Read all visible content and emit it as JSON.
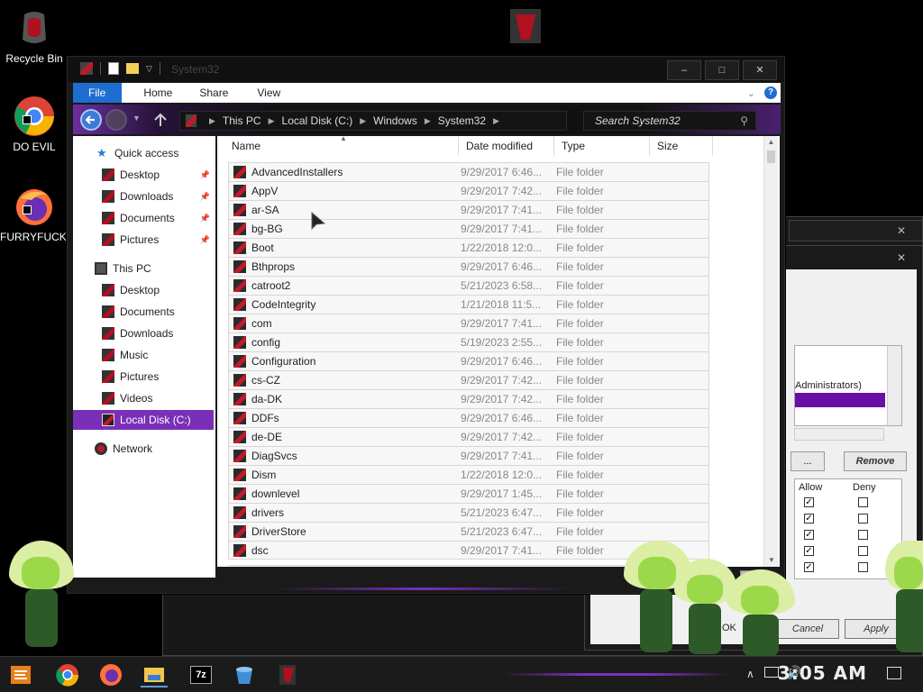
{
  "desktop": {
    "icons": [
      {
        "label": "Recycle Bin"
      },
      {
        "label": "DO EVIL"
      },
      {
        "label": "FURRYFUCK!"
      }
    ]
  },
  "explorer": {
    "title": "System32",
    "ribbon_tabs": [
      "File",
      "Home",
      "Share",
      "View"
    ],
    "breadcrumb": [
      "This PC",
      "Local Disk (C:)",
      "Windows",
      "System32"
    ],
    "search_placeholder": "Search System32",
    "nav": {
      "quick_access": "Quick access",
      "quick_items": [
        "Desktop",
        "Downloads",
        "Documents",
        "Pictures"
      ],
      "this_pc": "This PC",
      "pc_items": [
        "Desktop",
        "Documents",
        "Downloads",
        "Music",
        "Pictures",
        "Videos"
      ],
      "local_disk": "Local Disk (C:)",
      "network": "Network"
    },
    "columns": [
      "Name",
      "Date modified",
      "Type",
      "Size"
    ],
    "files": [
      {
        "name": "AdvancedInstallers",
        "date": "9/29/2017 6:46...",
        "type": "File folder"
      },
      {
        "name": "AppV",
        "date": "9/29/2017 7:42...",
        "type": "File folder"
      },
      {
        "name": "ar-SA",
        "date": "9/29/2017 7:41...",
        "type": "File folder"
      },
      {
        "name": "bg-BG",
        "date": "9/29/2017 7:41...",
        "type": "File folder"
      },
      {
        "name": "Boot",
        "date": "1/22/2018 12:0...",
        "type": "File folder"
      },
      {
        "name": "Bthprops",
        "date": "9/29/2017 6:46...",
        "type": "File folder"
      },
      {
        "name": "catroot2",
        "date": "5/21/2023 6:58...",
        "type": "File folder"
      },
      {
        "name": "CodeIntegrity",
        "date": "1/21/2018 11:5...",
        "type": "File folder"
      },
      {
        "name": "com",
        "date": "9/29/2017 7:41...",
        "type": "File folder"
      },
      {
        "name": "config",
        "date": "5/19/2023 2:55...",
        "type": "File folder"
      },
      {
        "name": "Configuration",
        "date": "9/29/2017 6:46...",
        "type": "File folder"
      },
      {
        "name": "cs-CZ",
        "date": "9/29/2017 7:42...",
        "type": "File folder"
      },
      {
        "name": "da-DK",
        "date": "9/29/2017 7:42...",
        "type": "File folder"
      },
      {
        "name": "DDFs",
        "date": "9/29/2017 6:46...",
        "type": "File folder"
      },
      {
        "name": "de-DE",
        "date": "9/29/2017 7:42...",
        "type": "File folder"
      },
      {
        "name": "DiagSvcs",
        "date": "9/29/2017 7:41...",
        "type": "File folder"
      },
      {
        "name": "Dism",
        "date": "1/22/2018 12:0...",
        "type": "File folder"
      },
      {
        "name": "downlevel",
        "date": "9/29/2017 1:45...",
        "type": "File folder"
      },
      {
        "name": "drivers",
        "date": "5/21/2023 6:47...",
        "type": "File folder"
      },
      {
        "name": "DriverStore",
        "date": "5/21/2023 6:47...",
        "type": "File folder"
      },
      {
        "name": "dsc",
        "date": "9/29/2017 7:41...",
        "type": "File folder"
      }
    ]
  },
  "background_dialog": {
    "list_item": "Administrators)",
    "add_button": "...",
    "remove_button": "Remove",
    "perm_headers": [
      "Allow",
      "Deny"
    ],
    "perms": [
      {
        "allow": true,
        "deny": false
      },
      {
        "allow": true,
        "deny": false
      },
      {
        "allow": true,
        "deny": false
      },
      {
        "allow": true,
        "deny": false
      },
      {
        "allow": true,
        "deny": false
      }
    ],
    "ok_label": "OK",
    "cancel_label": "Cancel",
    "apply_label": "Apply"
  },
  "taskbar": {
    "clock": "3:05 AM",
    "sevenzip_label": "7z"
  },
  "colors": {
    "accent": "#7a2fb8",
    "file_tab": "#1e6ed2"
  }
}
